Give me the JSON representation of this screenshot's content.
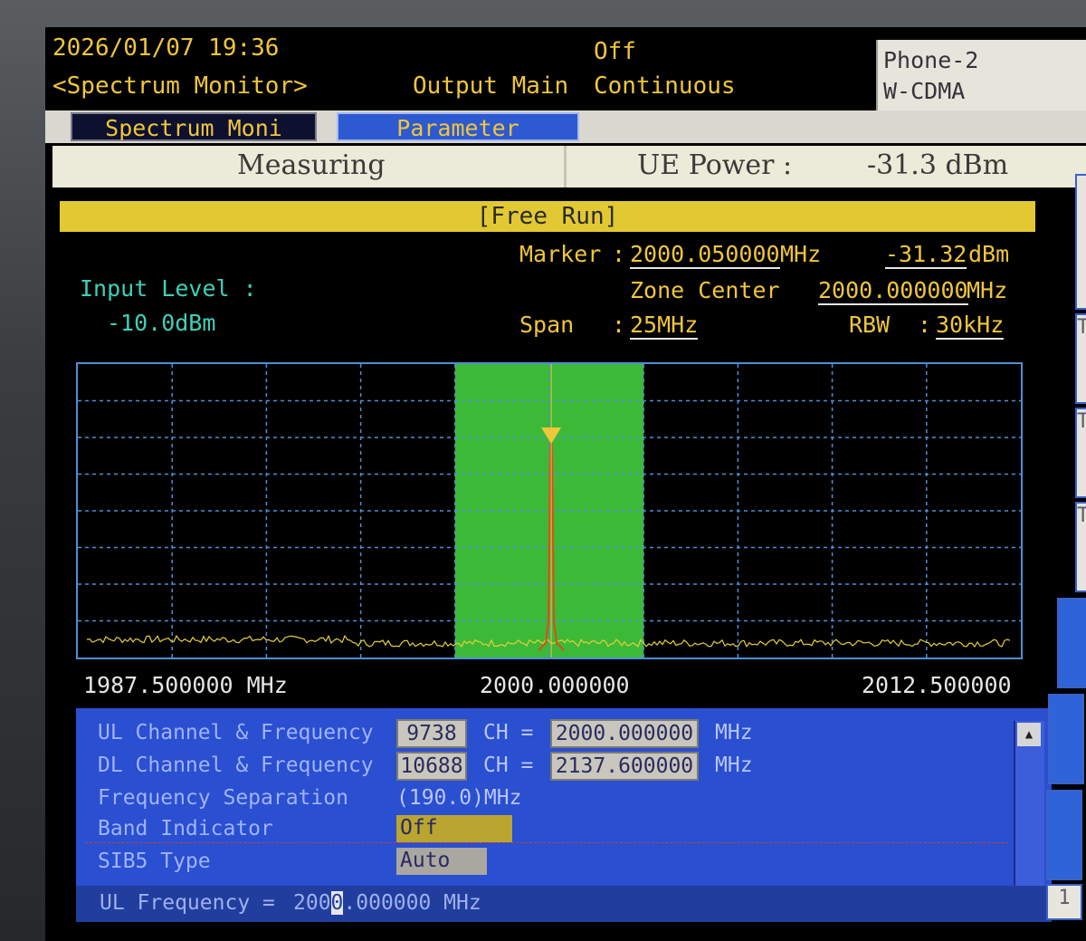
{
  "header": {
    "datetime": "2026/01/07 19:36",
    "screen_name": "<Spectrum Monitor>",
    "output_label": "Output Main",
    "output_state": "Off",
    "run_mode": "Continuous",
    "phone_name": "Phone-2",
    "system": "W-CDMA"
  },
  "tabs": [
    {
      "label": "Spectrum Moni",
      "active": true
    },
    {
      "label": "Parameter",
      "active": false
    }
  ],
  "status": {
    "state": "Measuring",
    "ue_power_label": "UE Power :",
    "ue_power_value": "-31.3 dBm",
    "trigger": "[Free Run]"
  },
  "marker": {
    "label": "Marker",
    "frequency": "2000.050000",
    "frequency_unit": "MHz",
    "level": "-31.32",
    "level_unit": "dBm"
  },
  "zone_center": {
    "label": "Zone Center",
    "value": "2000.000000",
    "unit": "MHz"
  },
  "span": {
    "label": "Span",
    "value": "25MHz"
  },
  "rbw": {
    "label": "RBW",
    "value": "30kHz"
  },
  "input_level": {
    "label": "Input Level :",
    "value": "-10.0dBm"
  },
  "chart_data": {
    "type": "line",
    "x_start_mhz": 1987.5,
    "x_center_mhz": 2000.0,
    "x_stop_mhz": 2012.5,
    "x_tick_labels": [
      "1987.500000 MHz",
      "2000.000000",
      "2012.500000"
    ],
    "zone_band_mhz": [
      1997.5,
      2002.5
    ],
    "marker_freq_mhz": 2000.05,
    "marker_level_dbm": -31.32,
    "grid": true,
    "colors": {
      "grid": "#4d8fd6",
      "zone": "#3fc43a",
      "trace": "#e6cf3a",
      "peak_trace": "#e04a1c",
      "marker": "#f0c63a"
    }
  },
  "panel": {
    "ul_label": "UL Channel & Frequency",
    "ul_channel": "9738",
    "ul_ch_sep": "CH =",
    "ul_freq": "2000.000000",
    "dl_label": "DL Channel & Frequency",
    "dl_channel": "10688",
    "dl_ch_sep": "CH =",
    "dl_freq": "2137.600000",
    "unit": "MHz",
    "sep_label": "Frequency Separation",
    "sep_value": "(190.0)MHz",
    "band_label": "Band Indicator",
    "band_value": "Off",
    "sib_label": "SIB5 Type",
    "sib_value": "Auto",
    "input_line_label": "UL Frequency =",
    "input_line_pre": "200",
    "input_line_cursor": "0",
    "input_line_post": ".000000 MHz"
  },
  "softkeys": [
    "",
    "TAG",
    "TAG",
    "TAG",
    "",
    "",
    "",
    "1"
  ]
}
